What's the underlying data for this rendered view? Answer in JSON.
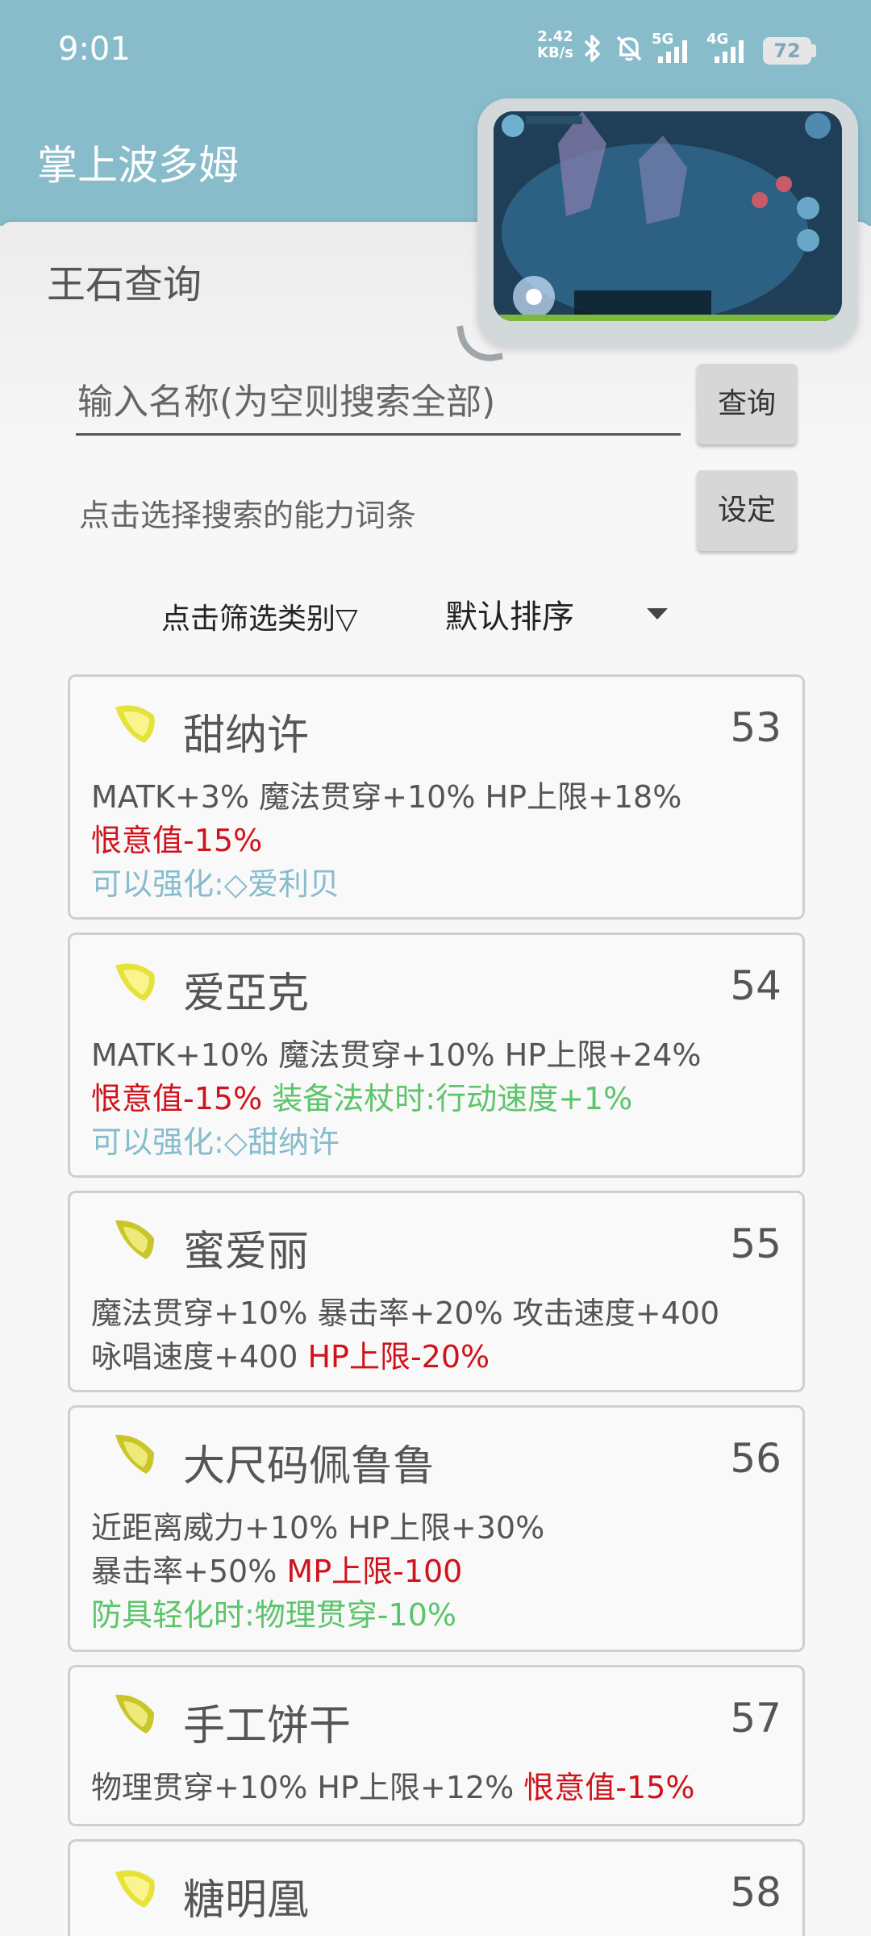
{
  "status_bar": {
    "time": "9:01",
    "net_speed_value": "2.42",
    "net_speed_unit": "KB/s",
    "signal_5g": "5G",
    "signal_4g": "4G",
    "battery": "72"
  },
  "app": {
    "title": "掌上波多姆"
  },
  "page": {
    "section_title": "王石查询",
    "search_placeholder": "输入名称(为空则搜索全部)",
    "query_button": "查询",
    "ability_hint": "点击选择搜索的能力词条",
    "set_button": "设定",
    "filter_label": "点击筛选类别▽",
    "sort_label": "默认排序"
  },
  "results": [
    {
      "name": "甜纳许",
      "num": "53",
      "line1": {
        "plain": "MATK+3% 魔法贯穿+10% HP上限+18%"
      },
      "line2": {
        "red": "恨意值-15%"
      },
      "line3": {
        "blue": "可以强化:◇爱利贝"
      }
    },
    {
      "name": "爱亞克",
      "num": "54",
      "line1": {
        "plain": "MATK+10% 魔法贯穿+10% HP上限+24%"
      },
      "line2": {
        "red": "恨意值-15%",
        "green": "装备法杖时:行动速度+1%"
      },
      "line3": {
        "blue": "可以强化:◇甜纳许"
      }
    },
    {
      "name": "蜜爱丽",
      "num": "55",
      "line1": {
        "plain": "魔法贯穿+10% 暴击率+20% 攻击速度+400"
      },
      "line2": {
        "plain": "咏唱速度+400",
        "red": "HP上限-20%"
      }
    },
    {
      "name": "大尺码佩鲁鲁",
      "num": "56",
      "line1": {
        "plain": "近距离威力+10% HP上限+30%"
      },
      "line2": {
        "plain": "暴击率+50%",
        "red": "MP上限-100"
      },
      "line3": {
        "green": "防具轻化时:物理贯穿-10%"
      }
    },
    {
      "name": "手工饼干",
      "num": "57",
      "line1": {
        "plain": "物理贯穿+10% HP上限+12%",
        "red": "恨意值-15%"
      }
    },
    {
      "name": "糖明凰",
      "num": "58"
    }
  ],
  "colors": {
    "header": "#89bccb",
    "negative": "#d0121b",
    "conditional": "#5cc46a",
    "enhance": "#87bccc"
  },
  "icons": {
    "gem": "yellow-gem-icon",
    "sort_dropdown": "caret-down-icon"
  }
}
